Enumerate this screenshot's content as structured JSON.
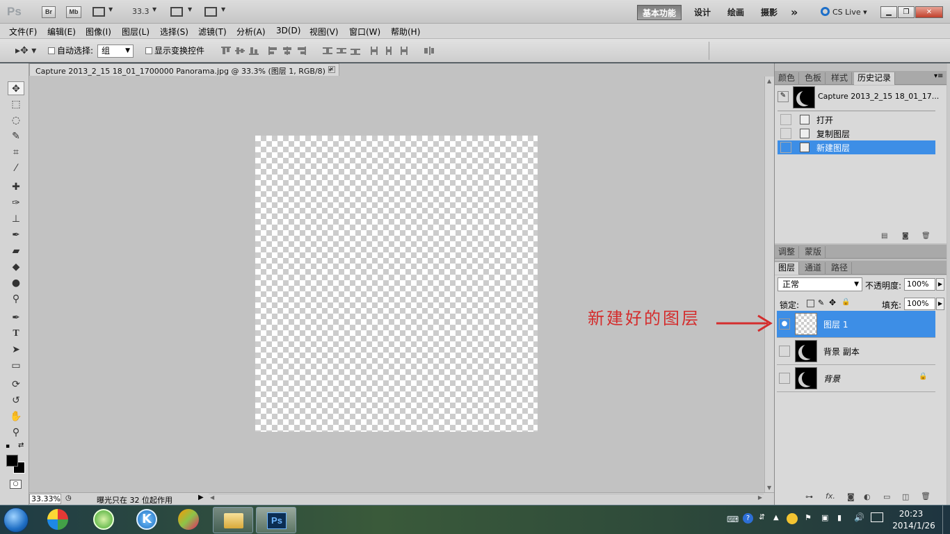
{
  "titlebar": {
    "app_logo": "Ps",
    "bridge_label": "Br",
    "minibridge_label": "Mb",
    "zoom_value": "33.3",
    "workspaces": [
      "基本功能",
      "设计",
      "绘画",
      "摄影"
    ],
    "more_label": "»",
    "cs_live": "CS Live"
  },
  "menubar": {
    "items": [
      "文件(F)",
      "编辑(E)",
      "图像(I)",
      "图层(L)",
      "选择(S)",
      "滤镜(T)",
      "分析(A)",
      "3D(D)",
      "视图(V)",
      "窗口(W)",
      "帮助(H)"
    ]
  },
  "options": {
    "auto_select_label": "自动选择:",
    "auto_select_value": "组",
    "show_transform_label": "显示变换控件"
  },
  "document": {
    "tab_title": "Capture 2013_2_15 18_01_1700000 Panorama.jpg @ 33.3% (图层 1, RGB/8) *",
    "status_zoom": "33.33%",
    "status_text": "曝光只在 32 位起作用"
  },
  "history_panel": {
    "tabs": [
      "颜色",
      "色板",
      "样式",
      "历史记录"
    ],
    "snapshot_name": "Capture 2013_2_15 18_01_17...",
    "states": [
      "打开",
      "复制图层",
      "新建图层"
    ]
  },
  "adjust_panel": {
    "tabs": [
      "调整",
      "蒙版"
    ]
  },
  "layers_panel": {
    "tabs": [
      "图层",
      "通道",
      "路径"
    ],
    "blend_mode": "正常",
    "opacity_label": "不透明度:",
    "opacity_value": "100%",
    "lock_label": "锁定:",
    "fill_label": "填充:",
    "fill_value": "100%",
    "layers": [
      "图层 1",
      "背景 副本",
      "背景"
    ]
  },
  "annotation": {
    "text": "新建好的图层",
    "color": "#d42d2d"
  },
  "taskbar": {
    "time": "20:23",
    "date": "2014/1/26"
  }
}
